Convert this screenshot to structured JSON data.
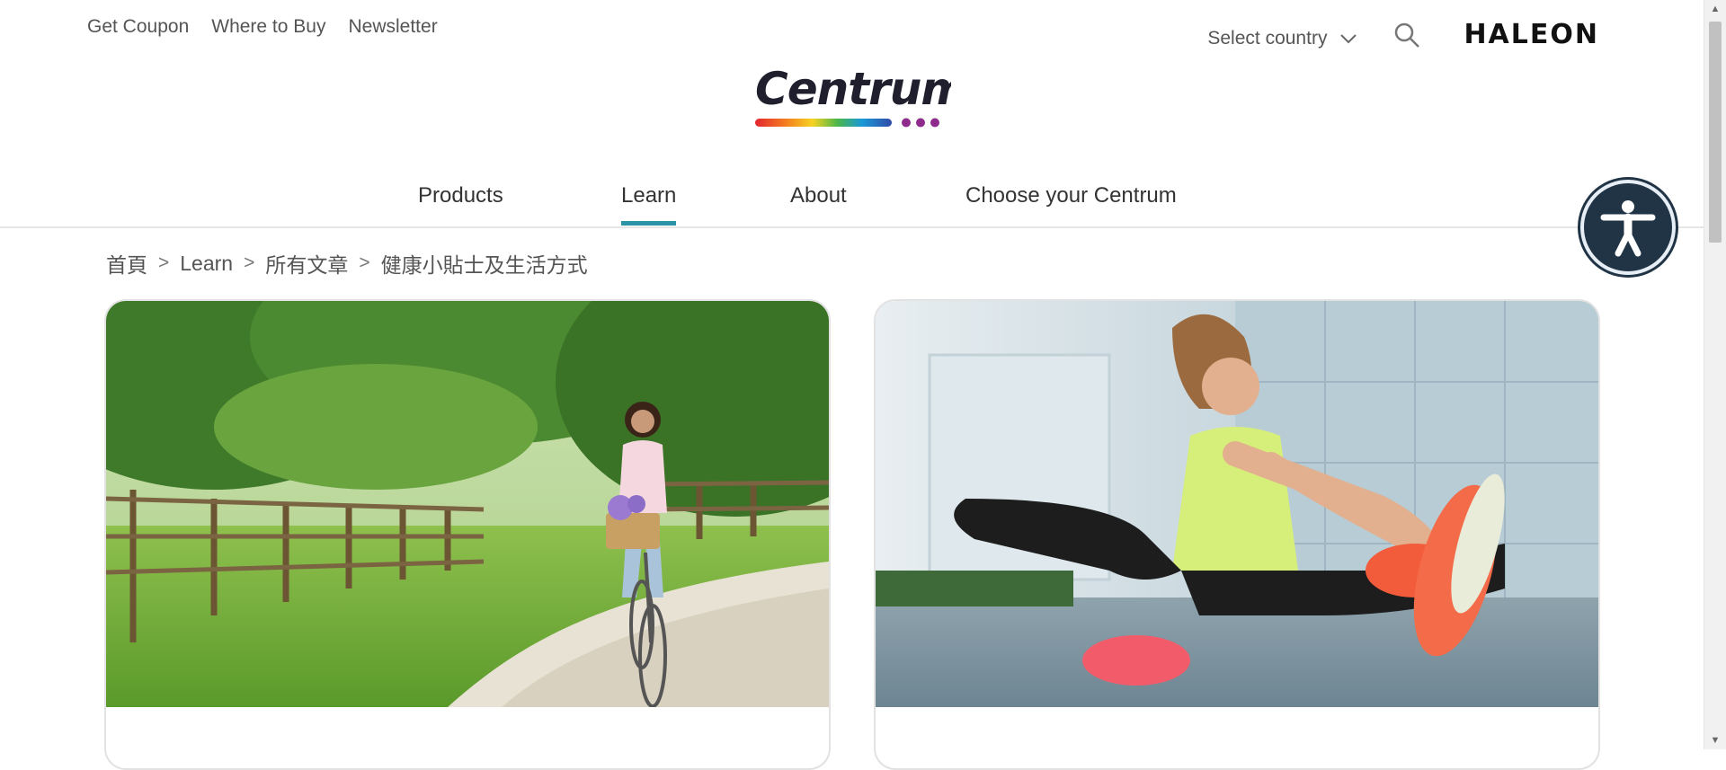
{
  "utility_nav": [
    "Get Coupon",
    "Where to Buy",
    "Newsletter"
  ],
  "country_select": {
    "label": "Select country"
  },
  "brand": {
    "haleon": "HALEON",
    "centrum": "Centrum"
  },
  "main_nav": {
    "items": [
      "Products",
      "Learn",
      "About",
      "Choose your Centrum"
    ],
    "active": "Learn"
  },
  "breadcrumb": [
    "首頁",
    "Learn",
    "所有文章",
    "健康小貼士及生活方式"
  ],
  "breadcrumb_separator": ">",
  "cards": [
    {
      "image": "woman-riding-bicycle-photo"
    },
    {
      "image": "woman-stretching-photo"
    }
  ],
  "icons": {
    "search": "search-icon",
    "dropdown": "chevron-down-icon",
    "accessibility": "accessibility-icon"
  },
  "colors": {
    "accent": "#2a93a6",
    "a11y_bg": "#213445"
  }
}
